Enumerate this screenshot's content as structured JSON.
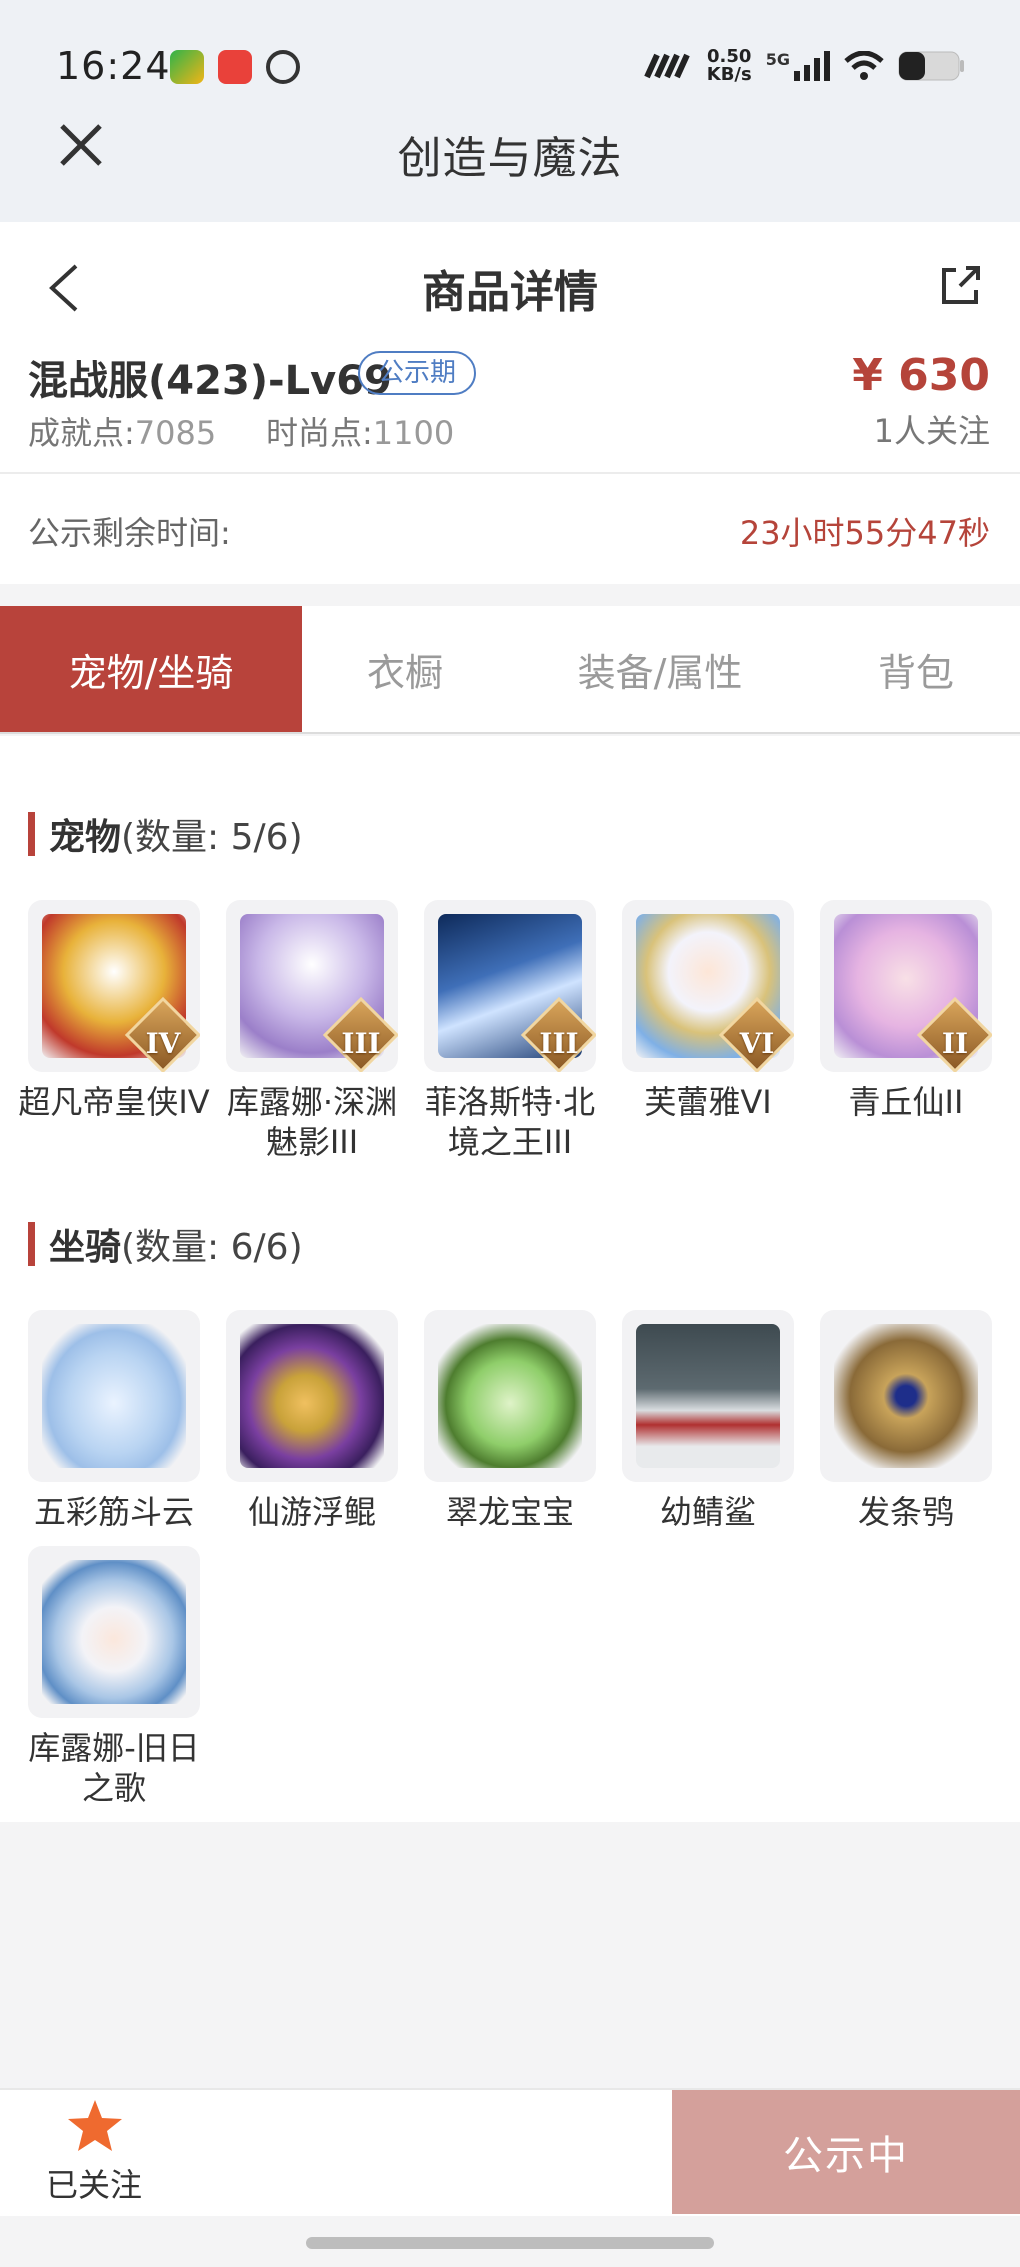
{
  "status_bar": {
    "time": "16:24",
    "network_speed_value": "0.50",
    "network_speed_unit": "KB/s",
    "network_type": "5G",
    "icons": [
      "video-app-icon",
      "store-app-icon",
      "mode-icon",
      "signal-icon",
      "wifi-icon",
      "battery-icon"
    ]
  },
  "app_header": {
    "title": "创造与魔法",
    "close_icon": "close-icon"
  },
  "detail": {
    "title": "商品详情",
    "item_name": "混战服(423)-Lv69",
    "badge": "公示期",
    "price": "¥ 630",
    "followers": "1人关注",
    "achievement_label": "成就点:",
    "achievement_value": "7085",
    "fashion_label": "时尚点:",
    "fashion_value": "1100",
    "remaining_label": "公示剩余时间:",
    "remaining_value": "23小时55分47秒"
  },
  "tabs": [
    {
      "label": "宠物/坐骑",
      "active": true
    },
    {
      "label": "衣橱",
      "active": false
    },
    {
      "label": "装备/属性",
      "active": false
    },
    {
      "label": "背包",
      "active": false
    }
  ],
  "pets": {
    "title": "宠物",
    "count": "(数量: 5/6)",
    "items": [
      {
        "name": "超凡帝皇侠IV",
        "rank": "IV",
        "color": "#e8b23a"
      },
      {
        "name": "库露娜·深渊魅影III",
        "rank": "III",
        "color": "#c9b8e8"
      },
      {
        "name": "菲洛斯特·北境之王III",
        "rank": "III",
        "color": "#3f6fb8"
      },
      {
        "name": "芙蕾雅VI",
        "rank": "VI",
        "color": "#d9c27a"
      },
      {
        "name": "青丘仙II",
        "rank": "II",
        "color": "#e6b4e2"
      }
    ]
  },
  "mounts": {
    "title": "坐骑",
    "count": "(数量: 6/6)",
    "items": [
      {
        "name": "五彩筋斗云",
        "color": "#b9d4f2"
      },
      {
        "name": "仙游浮鲲",
        "color": "#7a3fa0"
      },
      {
        "name": "翠龙宝宝",
        "color": "#8fce6a"
      },
      {
        "name": "幼鲭鲨",
        "color": "#5d6a70"
      },
      {
        "name": "发条鸮",
        "color": "#c8a35a"
      },
      {
        "name": "库露娜-旧日之歌",
        "color": "#a9c6e6"
      }
    ]
  },
  "bottom": {
    "followed_label": "已关注",
    "button_label": "公示中",
    "accent": "#b8433b"
  }
}
